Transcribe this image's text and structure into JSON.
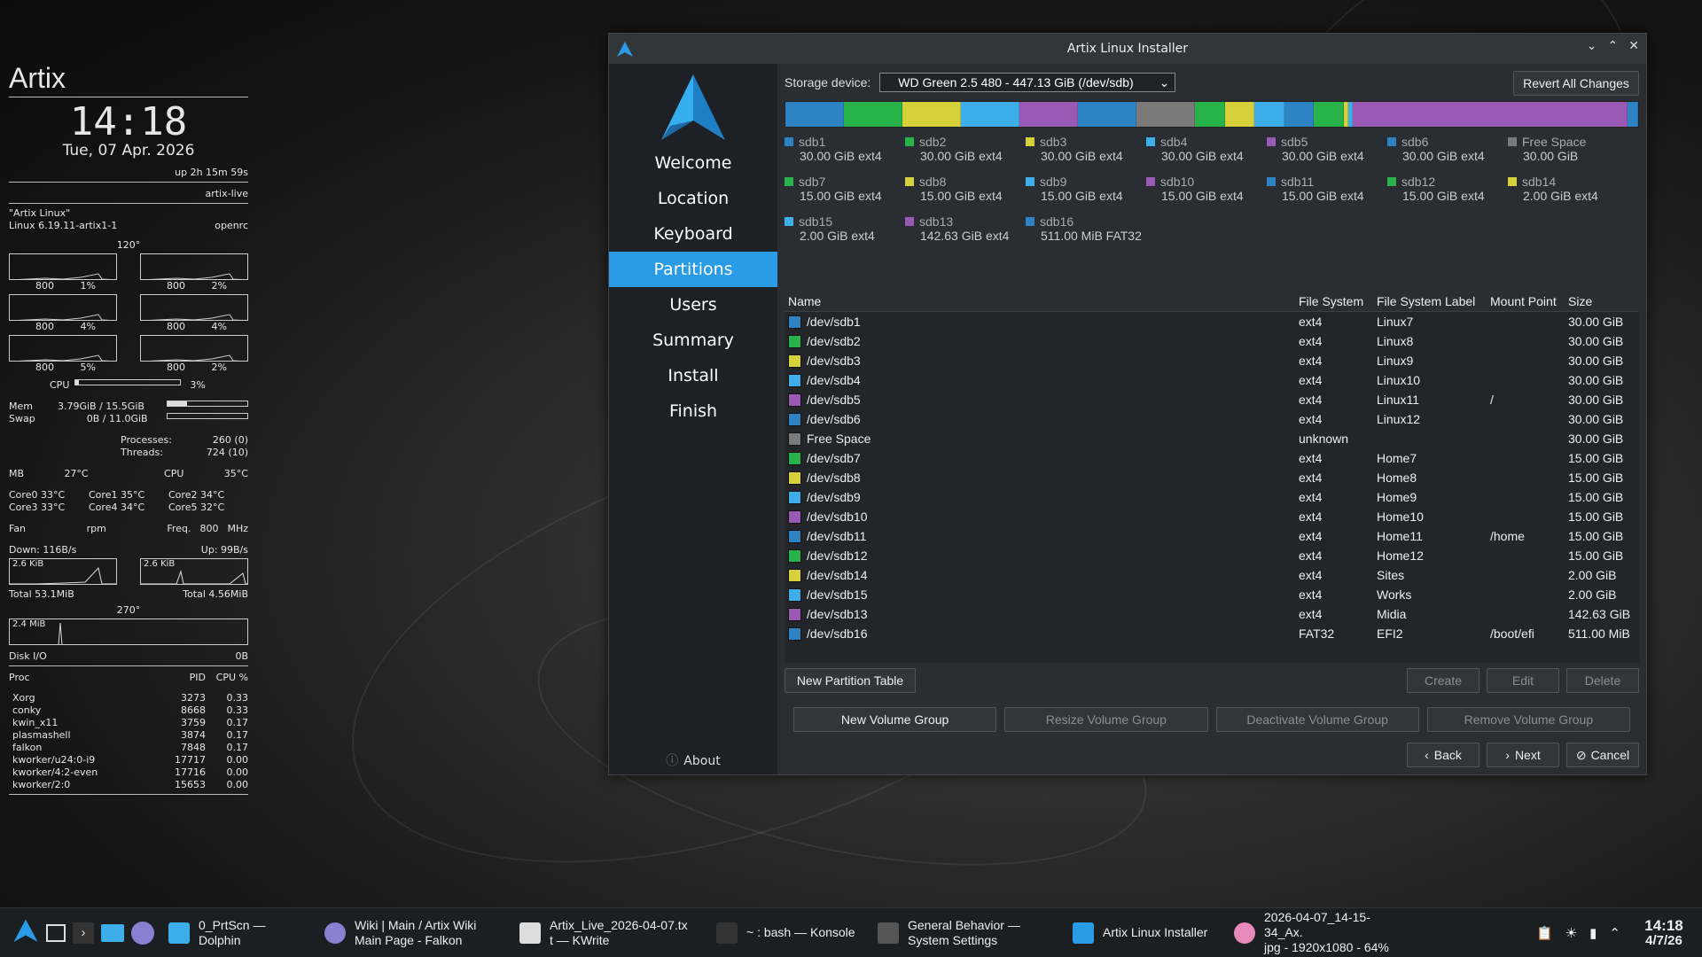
{
  "conky": {
    "distro": "Artix",
    "time": "14:18",
    "date": "Tue, 07 Apr. 2026",
    "uptime": "up  2h 15m 59s",
    "hostname": "artix-live",
    "os_name": "\"Artix Linux\"",
    "kernel": "Linux 6.19.11-artix1-1",
    "init": "openrc",
    "angle_top": "120°",
    "cores": [
      {
        "freq": "800",
        "pct": "1%"
      },
      {
        "freq": "800",
        "pct": "2%"
      },
      {
        "freq": "800",
        "pct": "4%"
      },
      {
        "freq": "800",
        "pct": "4%"
      },
      {
        "freq": "800",
        "pct": "5%"
      },
      {
        "freq": "800",
        "pct": "2%"
      }
    ],
    "cpu_label": "CPU",
    "cpu_pct": "3%",
    "cpu_level": 3,
    "mem_label": "Mem",
    "mem_value": "3.79GiB / 15.5GiB",
    "mem_level": 24,
    "swap_label": "Swap",
    "swap_value": "0B / 11.0GiB",
    "swap_level": 0,
    "processes_label": "Processes:",
    "processes_value": "260 (0)",
    "threads_label": "Threads:",
    "threads_value": "724 (10)",
    "mb_label": "MB",
    "mb_temp": "27°C",
    "cpu_temp_label": "CPU",
    "cpu_temp": "35°C",
    "core_temps": [
      "Core0 33°C",
      "Core1 35°C",
      "Core2 34°C",
      "Core3 33°C",
      "Core4 34°C",
      "Core5 32°C"
    ],
    "fan_label": "Fan",
    "fan_unit": "rpm",
    "freq_label": "Freq.",
    "freq_value": "800",
    "freq_unit": "MHz",
    "down": "Down: 116B/s",
    "up": "Up: 99B/s",
    "down_graph": "2.6 KiB",
    "up_graph": "2.6 KiB",
    "total_down": "Total 53.1MiB",
    "total_up": "Total 4.56MiB",
    "angle_bottom": "270°",
    "disk_graph": "2.4 MiB",
    "disk_label": "Disk I/O",
    "disk_value": "0B",
    "proc_header": [
      "Proc",
      "PID",
      "CPU %"
    ],
    "procs": [
      [
        "Xorg",
        "3273",
        "0.33"
      ],
      [
        "conky",
        "8668",
        "0.33"
      ],
      [
        "kwin_x11",
        "3759",
        "0.17"
      ],
      [
        "plasmashell",
        "3874",
        "0.17"
      ],
      [
        "falkon",
        "7848",
        "0.17"
      ],
      [
        "kworker/u24:0-i9",
        "17717",
        "0.00"
      ],
      [
        "kworker/4:2-even",
        "17716",
        "0.00"
      ],
      [
        "kworker/2:0",
        "15653",
        "0.00"
      ]
    ]
  },
  "window": {
    "title": "Artix Linux Installer",
    "sidebar": [
      "Welcome",
      "Location",
      "Keyboard",
      "Partitions",
      "Users",
      "Summary",
      "Install",
      "Finish"
    ],
    "active_step": "Partitions",
    "about": "About",
    "storage_label": "Storage device:",
    "storage_value": "WD Green 2.5 480 - 447.13 GiB (/dev/sdb)",
    "revert": "Revert All Changes",
    "colors": {
      "blue": "#2e83c5",
      "green": "#27b24a",
      "yellow": "#d6d03a",
      "cyan": "#3daee9",
      "purple": "#9b59b6",
      "grey": "#7a7a7a",
      "darkblue": "#2a6fad"
    },
    "legend": [
      {
        "name": "sdb1",
        "size": "30.00 GiB",
        "fs": "ext4",
        "color": "#2e83c5"
      },
      {
        "name": "sdb2",
        "size": "30.00 GiB",
        "fs": "ext4",
        "color": "#27b24a"
      },
      {
        "name": "sdb3",
        "size": "30.00 GiB",
        "fs": "ext4",
        "color": "#d6d03a"
      },
      {
        "name": "sdb4",
        "size": "30.00 GiB",
        "fs": "ext4",
        "color": "#3daee9"
      },
      {
        "name": "sdb5",
        "size": "30.00 GiB",
        "fs": "ext4",
        "color": "#9b59b6"
      },
      {
        "name": "sdb6",
        "size": "30.00 GiB",
        "fs": "ext4",
        "color": "#2e83c5"
      },
      {
        "name": "Free Space",
        "size": "30.00 GiB",
        "fs": "",
        "color": "#7a7a7a"
      },
      {
        "name": "sdb7",
        "size": "15.00 GiB",
        "fs": "ext4",
        "color": "#27b24a"
      },
      {
        "name": "sdb8",
        "size": "15.00 GiB",
        "fs": "ext4",
        "color": "#d6d03a"
      },
      {
        "name": "sdb9",
        "size": "15.00 GiB",
        "fs": "ext4",
        "color": "#3daee9"
      },
      {
        "name": "sdb10",
        "size": "15.00 GiB",
        "fs": "ext4",
        "color": "#9b59b6"
      },
      {
        "name": "sdb11",
        "size": "15.00 GiB",
        "fs": "ext4",
        "color": "#2e83c5"
      },
      {
        "name": "sdb12",
        "size": "15.00 GiB",
        "fs": "ext4",
        "color": "#27b24a"
      },
      {
        "name": "sdb14",
        "size": "2.00 GiB",
        "fs": "ext4",
        "color": "#d6d03a"
      },
      {
        "name": "sdb15",
        "size": "2.00 GiB",
        "fs": "ext4",
        "color": "#3daee9"
      },
      {
        "name": "sdb13",
        "size": "142.63 GiB",
        "fs": "ext4",
        "color": "#9b59b6"
      },
      {
        "name": "sdb16",
        "size": "511.00 MiB",
        "fs": "FAT32",
        "color": "#2e83c5"
      }
    ],
    "bar_segments": [
      {
        "color": "#2e83c5",
        "gib": 30
      },
      {
        "color": "#27b24a",
        "gib": 30
      },
      {
        "color": "#d6d03a",
        "gib": 30
      },
      {
        "color": "#3daee9",
        "gib": 30
      },
      {
        "color": "#9b59b6",
        "gib": 30
      },
      {
        "color": "#2e83c5",
        "gib": 30
      },
      {
        "color": "#7a7a7a",
        "gib": 30
      },
      {
        "color": "#27b24a",
        "gib": 15
      },
      {
        "color": "#d6d03a",
        "gib": 15
      },
      {
        "color": "#3daee9",
        "gib": 15
      },
      {
        "color": "#2e83c5",
        "gib": 15
      },
      {
        "color": "#27b24a",
        "gib": 15
      },
      {
        "color": "#d6d03a",
        "gib": 2
      },
      {
        "color": "#3daee9",
        "gib": 2
      },
      {
        "color": "#9b59b6",
        "gib": 142.63
      },
      {
        "color": "#2e83c5",
        "gib": 5
      }
    ],
    "table_headers": [
      "Name",
      "File System",
      "File System Label",
      "Mount Point",
      "Size"
    ],
    "rows": [
      {
        "name": "/dev/sdb1",
        "fs": "ext4",
        "label": "Linux7",
        "mount": "",
        "size": "30.00 GiB",
        "color": "#2e83c5"
      },
      {
        "name": "/dev/sdb2",
        "fs": "ext4",
        "label": "Linux8",
        "mount": "",
        "size": "30.00 GiB",
        "color": "#27b24a"
      },
      {
        "name": "/dev/sdb3",
        "fs": "ext4",
        "label": "Linux9",
        "mount": "",
        "size": "30.00 GiB",
        "color": "#d6d03a"
      },
      {
        "name": "/dev/sdb4",
        "fs": "ext4",
        "label": "Linux10",
        "mount": "",
        "size": "30.00 GiB",
        "color": "#3daee9"
      },
      {
        "name": "/dev/sdb5",
        "fs": "ext4",
        "label": "Linux11",
        "mount": "/",
        "size": "30.00 GiB",
        "color": "#9b59b6"
      },
      {
        "name": "/dev/sdb6",
        "fs": "ext4",
        "label": "Linux12",
        "mount": "",
        "size": "30.00 GiB",
        "color": "#2e83c5"
      },
      {
        "name": "Free Space",
        "fs": "unknown",
        "label": "",
        "mount": "",
        "size": "30.00 GiB",
        "color": "#7a7a7a"
      },
      {
        "name": "/dev/sdb7",
        "fs": "ext4",
        "label": "Home7",
        "mount": "",
        "size": "15.00 GiB",
        "color": "#27b24a"
      },
      {
        "name": "/dev/sdb8",
        "fs": "ext4",
        "label": "Home8",
        "mount": "",
        "size": "15.00 GiB",
        "color": "#d6d03a"
      },
      {
        "name": "/dev/sdb9",
        "fs": "ext4",
        "label": "Home9",
        "mount": "",
        "size": "15.00 GiB",
        "color": "#3daee9"
      },
      {
        "name": "/dev/sdb10",
        "fs": "ext4",
        "label": "Home10",
        "mount": "",
        "size": "15.00 GiB",
        "color": "#9b59b6"
      },
      {
        "name": "/dev/sdb11",
        "fs": "ext4",
        "label": "Home11",
        "mount": "/home",
        "size": "15.00 GiB",
        "color": "#2e83c5"
      },
      {
        "name": "/dev/sdb12",
        "fs": "ext4",
        "label": "Home12",
        "mount": "",
        "size": "15.00 GiB",
        "color": "#27b24a"
      },
      {
        "name": "/dev/sdb14",
        "fs": "ext4",
        "label": "Sites",
        "mount": "",
        "size": "2.00 GiB",
        "color": "#d6d03a"
      },
      {
        "name": "/dev/sdb15",
        "fs": "ext4",
        "label": "Works",
        "mount": "",
        "size": "2.00 GiB",
        "color": "#3daee9"
      },
      {
        "name": "/dev/sdb13",
        "fs": "ext4",
        "label": "Midia",
        "mount": "",
        "size": "142.63 GiB",
        "color": "#9b59b6"
      },
      {
        "name": "/dev/sdb16",
        "fs": "FAT32",
        "label": "EFI2",
        "mount": "/boot/efi",
        "size": "511.00 MiB",
        "color": "#2e83c5"
      }
    ],
    "new_partition_table": "New Partition Table",
    "create": "Create",
    "edit": "Edit",
    "delete": "Delete",
    "new_vg": "New Volume Group",
    "resize_vg": "Resize Volume Group",
    "deactivate_vg": "Deactivate Volume Group",
    "remove_vg": "Remove Volume Group",
    "back": "Back",
    "next": "Next",
    "cancel": "Cancel"
  },
  "taskbar": {
    "tasks": [
      {
        "label": "0_PrtScn — Dolphin",
        "icon": "dolphin-icon"
      },
      {
        "label": "Wiki | Main / Artix Wiki\nMain Page - Falkon",
        "icon": "falkon-icon"
      },
      {
        "label": "Artix_Live_2026-04-07.tx\nt — KWrite",
        "icon": "kwrite-icon"
      },
      {
        "label": "~ : bash — Konsole",
        "icon": "konsole-icon"
      },
      {
        "label": "General Behavior —\nSystem Settings",
        "icon": "settings-icon"
      },
      {
        "label": "Artix Linux Installer",
        "icon": "artix-icon"
      },
      {
        "label": "2026-04-07_14-15-34_Ax.\njpg - 1920x1080 - 64%",
        "icon": "image-viewer-icon"
      }
    ],
    "time": "14:18",
    "date": "4/7/26"
  }
}
